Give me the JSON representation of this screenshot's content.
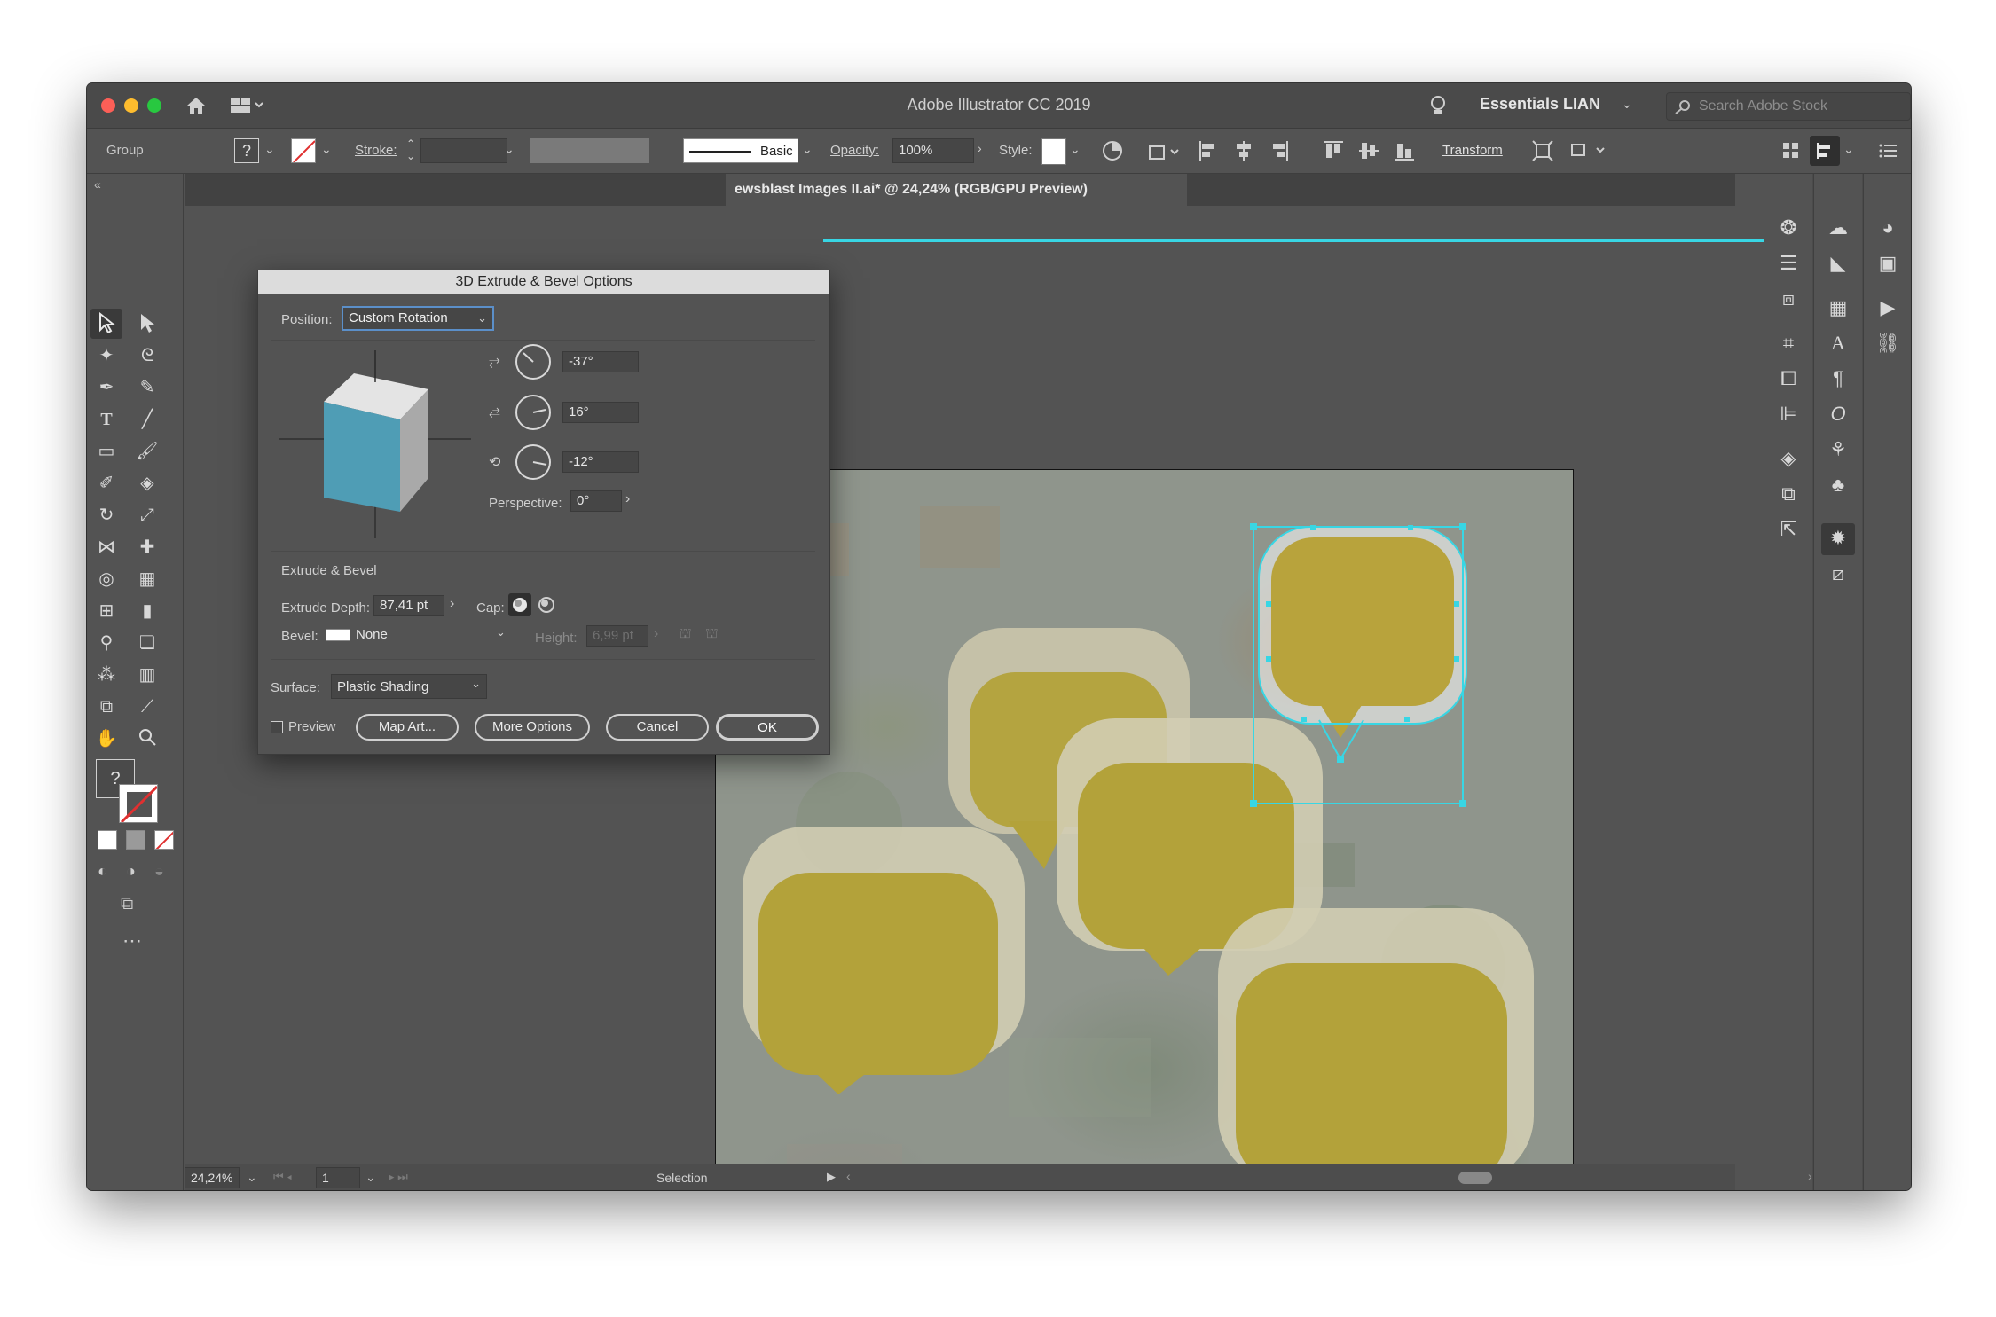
{
  "window": {
    "title": "Adobe Illustrator CC 2019"
  },
  "header": {
    "workspace": "Essentials LIAN",
    "search_placeholder": "Search Adobe Stock"
  },
  "control_bar": {
    "selection_type": "Group",
    "stroke_label": "Stroke:",
    "stroke_style": "Basic",
    "opacity_label": "Opacity:",
    "opacity_value": "100%",
    "style_label": "Style:",
    "transform_label": "Transform"
  },
  "document": {
    "tab_title": "ewsblast Images II.ai* @ 24,24% (RGB/GPU Preview)"
  },
  "dialog": {
    "title": "3D Extrude & Bevel Options",
    "position_label": "Position:",
    "position_value": "Custom Rotation",
    "rotation_x": "-37°",
    "rotation_y": "16°",
    "rotation_z": "-12°",
    "perspective_label": "Perspective:",
    "perspective_value": "0°",
    "extrude_section": "Extrude & Bevel",
    "extrude_depth_label": "Extrude Depth:",
    "extrude_depth_value": "87,41 pt",
    "cap_label": "Cap:",
    "bevel_label": "Bevel:",
    "bevel_value": "None",
    "height_label": "Height:",
    "height_value": "6,99 pt",
    "surface_label": "Surface:",
    "surface_value": "Plastic Shading",
    "preview_label": "Preview",
    "map_art_button": "Map Art...",
    "more_options_button": "More Options",
    "cancel_button": "Cancel",
    "ok_button": "OK"
  },
  "status": {
    "zoom": "24,24%",
    "artboard_number": "1",
    "tool_name": "Selection"
  },
  "colors": {
    "cube_front": "#4f9db5",
    "bubble_fill": "#b8a33c",
    "selection": "#38d6e4"
  },
  "icons": [
    "home-icon",
    "arrange-documents-icon",
    "lightbulb-icon",
    "search-icon",
    "selection-tool-icon",
    "direct-selection-tool-icon",
    "pen-tool-icon",
    "type-tool-icon",
    "rectangle-tool-icon",
    "hand-tool-icon",
    "zoom-tool-icon"
  ]
}
